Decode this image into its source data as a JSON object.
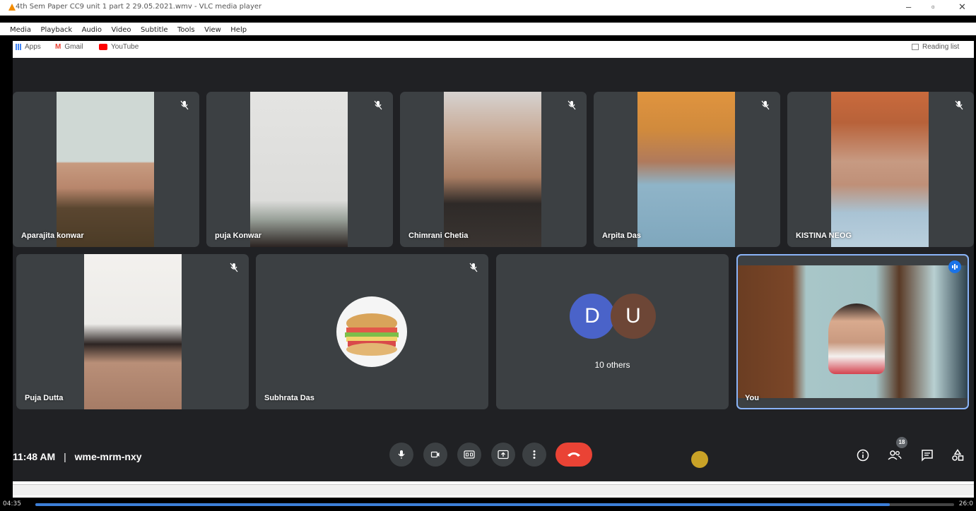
{
  "vlc": {
    "title": "4th Sem Paper CC9 unit 1 part 2 29.05.2021.wmv - VLC media player",
    "menu": [
      "Media",
      "Playback",
      "Audio",
      "Video",
      "Subtitle",
      "Tools",
      "View",
      "Help"
    ],
    "time_elapsed": "04:35",
    "time_total": "26:0",
    "progress": 0.93
  },
  "bookmarks": {
    "apps": "Apps",
    "gmail": "Gmail",
    "youtube": "YouTube",
    "reading_list": "Reading list"
  },
  "participants": [
    {
      "name": "Aparajita konwar",
      "muted": true
    },
    {
      "name": "puja Konwar",
      "muted": true
    },
    {
      "name": "Chimrani Chetia",
      "muted": true
    },
    {
      "name": "Arpita Das",
      "muted": true
    },
    {
      "name": "KISTINA NEOG",
      "muted": true
    },
    {
      "name": "Puja Dutta",
      "muted": true
    },
    {
      "name": "Subhrata Das",
      "muted": true
    }
  ],
  "others": {
    "avatar1": "D",
    "avatar2": "U",
    "label": "10 others",
    "avatar1_color": "#4a63c9",
    "avatar2_color": "#6d4636"
  },
  "self": {
    "name": "You"
  },
  "meeting": {
    "time": "11:48 AM",
    "separator": "|",
    "code": "wme-mrm-nxy",
    "participant_count": "18"
  },
  "colors": {
    "background": "#202124",
    "tile": "#3c4043",
    "end_call": "#ea4335",
    "speaking": "#1a73e8"
  }
}
